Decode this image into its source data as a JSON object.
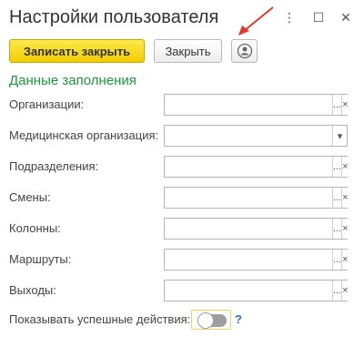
{
  "window": {
    "title": "Настройки пользователя",
    "more_glyph": "⋮",
    "maximize_glyph": "☐",
    "close_glyph": "✕"
  },
  "toolbar": {
    "save_close_label": "Записать закрыть",
    "close_label": "Закрыть",
    "user_icon": "user-circle-icon"
  },
  "section": {
    "title": "Данные заполнения"
  },
  "fields": [
    {
      "label": "Организации:",
      "value": "",
      "buttons": [
        "...",
        "×"
      ]
    },
    {
      "label": "Медицинская организация:",
      "value": "",
      "buttons": [
        "▾"
      ]
    },
    {
      "label": "Подразделения:",
      "value": "",
      "buttons": [
        "...",
        "×"
      ]
    },
    {
      "label": "Смены:",
      "value": "",
      "buttons": [
        "...",
        "×"
      ]
    },
    {
      "label": "Колонны:",
      "value": "",
      "buttons": [
        "...",
        "×"
      ]
    },
    {
      "label": "Маршруты:",
      "value": "",
      "buttons": [
        "...",
        "×"
      ]
    },
    {
      "label": "Выходы:",
      "value": "",
      "buttons": [
        "...",
        "×"
      ]
    }
  ],
  "toggle": {
    "label": "Показывать успешные действия:",
    "state": "off",
    "help": "?"
  },
  "colors": {
    "accent_yellow": "#f2cd00",
    "section_green": "#1a9a3d",
    "arrow_red": "#e0392b",
    "help_blue": "#2f6fd0"
  }
}
